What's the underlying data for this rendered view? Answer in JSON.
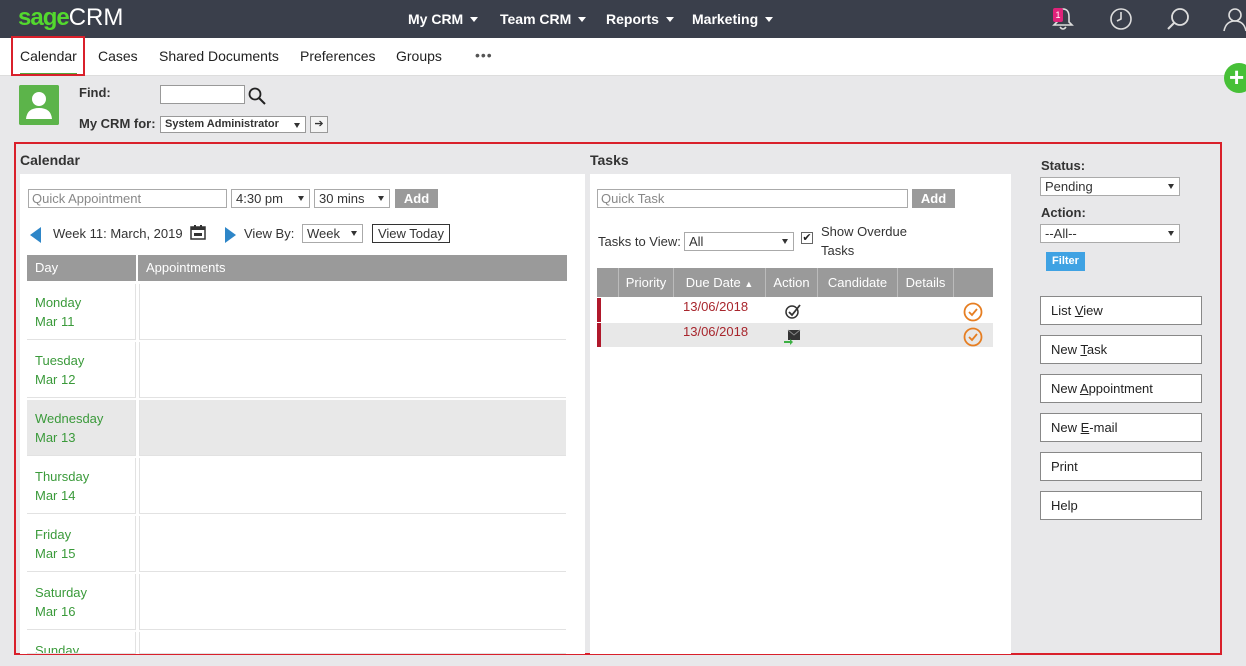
{
  "header": {
    "logo_sage": "sage",
    "logo_crm": "CRM",
    "nav": [
      "My CRM",
      "Team CRM",
      "Reports",
      "Marketing"
    ],
    "notification_count": "1"
  },
  "tabs": [
    "Calendar",
    "Cases",
    "Shared Documents",
    "Preferences",
    "Groups"
  ],
  "more_label": "•••",
  "find": {
    "find_label": "Find:",
    "mycrm_label": "My CRM for:",
    "user_selected": "System Administrator",
    "go_glyph": "➔"
  },
  "calendar": {
    "title": "Calendar",
    "quick_appt_placeholder": "Quick Appointment",
    "time_selected": "4:30 pm",
    "duration_selected": "30 mins",
    "add_label": "Add",
    "week_label": "Week 11: March, 2019",
    "view_by_label": "View By:",
    "view_by_selected": "Week",
    "view_today_label": "View Today",
    "col_day": "Day",
    "col_appointments": "Appointments",
    "days": [
      {
        "name": "Monday",
        "date": "Mar 11"
      },
      {
        "name": "Tuesday",
        "date": "Mar 12"
      },
      {
        "name": "Wednesday",
        "date": "Mar 13"
      },
      {
        "name": "Thursday",
        "date": "Mar 14"
      },
      {
        "name": "Friday",
        "date": "Mar 15"
      },
      {
        "name": "Saturday",
        "date": "Mar 16"
      },
      {
        "name": "Sunday",
        "date": ""
      }
    ]
  },
  "tasks": {
    "title": "Tasks",
    "quick_task_placeholder": "Quick Task",
    "add_label": "Add",
    "tasks_to_view_label": "Tasks to View:",
    "tasks_to_view_selected": "All",
    "show_overdue_label": "Show Overdue Tasks",
    "columns": [
      "Priority",
      "Due Date",
      "Action",
      "Candidate",
      "Details"
    ],
    "sort_glyph": "▲",
    "rows": [
      {
        "due_date": "13/06/2018"
      },
      {
        "due_date": "13/06/2018"
      }
    ]
  },
  "filters": {
    "status_label": "Status:",
    "status_selected": "Pending",
    "action_label": "Action:",
    "action_selected": "--All--",
    "filter_label": "Filter"
  },
  "actions": {
    "list_view_pre": "List ",
    "list_view_ul": "V",
    "list_view_post": "iew",
    "new_task_pre": "New ",
    "new_task_ul": "T",
    "new_task_post": "ask",
    "new_appt_pre": "New ",
    "new_appt_ul": "A",
    "new_appt_post": "ppointment",
    "new_email_pre": "New ",
    "new_email_ul": "E",
    "new_email_post": "-mail",
    "print": "Print",
    "help": "Help"
  },
  "plus_glyph": "+",
  "colors": {
    "topbar": "#3a3f4b",
    "brand_green": "#53d82e",
    "highlight_red": "#d9202b",
    "day_green": "#3a9a3a",
    "date_red": "#a8262d",
    "filter_blue": "#3fa2e3"
  }
}
